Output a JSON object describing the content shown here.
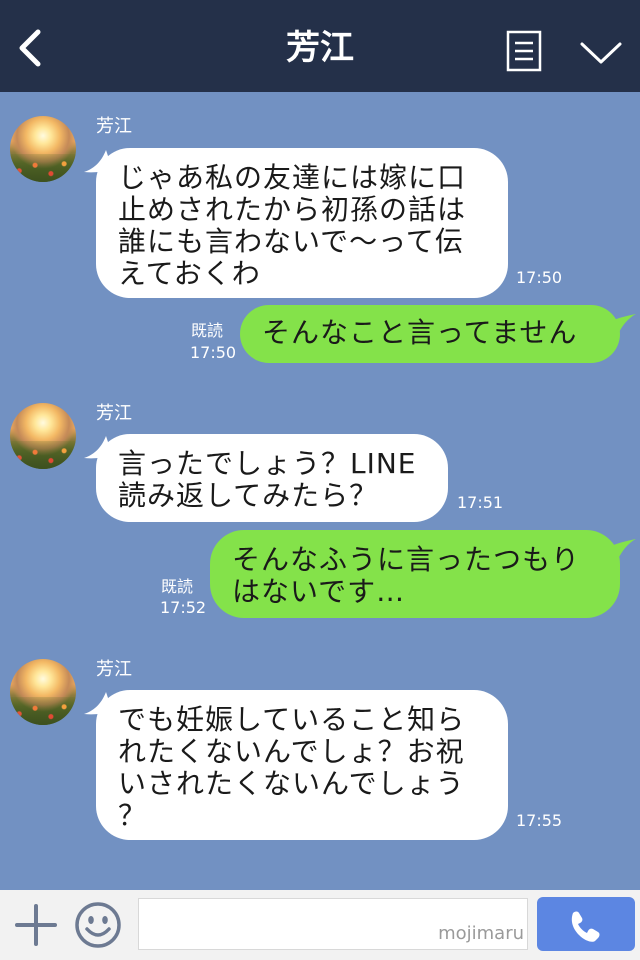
{
  "header": {
    "title": "芳江"
  },
  "messages": [
    {
      "side": "left",
      "sender": "芳江",
      "lines": [
        "じゃあ私の友達には嫁に口",
        "止めされたから初孫の話は",
        "誰にも言わないで〜って伝",
        "えておくわ"
      ],
      "time": "17:50"
    },
    {
      "side": "right",
      "lines": [
        "そんなこと言ってません"
      ],
      "read": "既読",
      "time": "17:50"
    },
    {
      "side": "left",
      "sender": "芳江",
      "lines": [
        "言ったでしょう？LINE",
        "読み返してみたら？"
      ],
      "time": "17:51"
    },
    {
      "side": "right",
      "lines": [
        "そんなふうに言ったつもり",
        "はないです…"
      ],
      "read": "既読",
      "time": "17:52"
    },
    {
      "side": "left",
      "sender": "芳江",
      "lines": [
        "でも妊娠していること知ら",
        "れたくないんでしょ？お祝",
        "いされたくないんでしょう",
        "？"
      ],
      "time": "17:55"
    }
  ],
  "input": {
    "watermark": "mojimaru"
  },
  "colors": {
    "header_bg": "#243049",
    "chat_bg": "#7291c2",
    "sent_bubble": "#84e24a",
    "received_bubble": "#ffffff",
    "call_button": "#5c86e2"
  },
  "icons": {
    "back": "chevron-left-icon",
    "menu": "list-icon",
    "collapse": "chevron-down-icon",
    "plus": "plus-icon",
    "sticker": "smiley-icon",
    "call": "phone-icon"
  }
}
